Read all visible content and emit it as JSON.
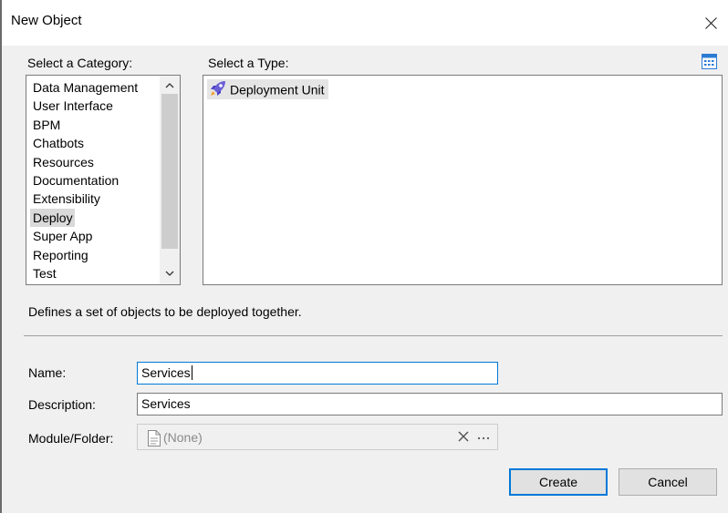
{
  "window": {
    "title": "New Object"
  },
  "category": {
    "label": "Select a Category:",
    "items": [
      "Data Management",
      "User Interface",
      "BPM",
      "Chatbots",
      "Resources",
      "Documentation",
      "Extensibility",
      "Deploy",
      "Super App",
      "Reporting",
      "Test"
    ],
    "selected": "Deploy"
  },
  "type": {
    "label": "Select a Type:",
    "items": [
      {
        "label": "Deployment Unit",
        "icon": "rocket-icon"
      }
    ]
  },
  "description_text": "Defines a set of objects to be deployed together.",
  "form": {
    "name_label": "Name:",
    "name_value": "Services",
    "description_label": "Description:",
    "description_value": "Services",
    "module_label": "Module/Folder:",
    "module_value": "(None)"
  },
  "buttons": {
    "create": "Create",
    "cancel": "Cancel"
  },
  "colors": {
    "accent": "#0078d7",
    "dialog_bg": "#f0f0f0",
    "selection": "#d9d9d9"
  }
}
